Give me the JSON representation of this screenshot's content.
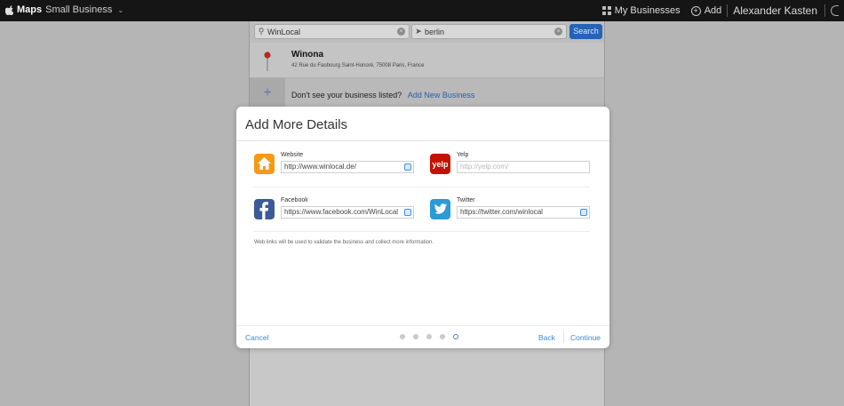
{
  "topbar": {
    "brand_bold": "Maps",
    "brand_rest": "Small Business",
    "my_businesses": "My Businesses",
    "add": "Add",
    "user": "Alexander Kasten"
  },
  "search": {
    "query": "WinLocal",
    "location": "berlin",
    "button": "Search"
  },
  "result": {
    "name": "Winona",
    "address": "42 Rue du Faubourg Saint-Honoré, 75008 Paris, France"
  },
  "add_row": {
    "question": "Don't see your business listed?",
    "link": "Add New Business"
  },
  "modal": {
    "title": "Add More Details",
    "website": {
      "label": "Website",
      "value": "http://www.winlocal.de/"
    },
    "yelp": {
      "label": "Yelp",
      "placeholder": "http://yelp.com/"
    },
    "facebook": {
      "label": "Facebook",
      "value": "https://www.facebook.com/WinLocal"
    },
    "twitter": {
      "label": "Twitter",
      "value": "https://twitter.com/winlocal"
    },
    "note": "Web links will be used to validate the business and collect more information.",
    "cancel": "Cancel",
    "back": "Back",
    "continue": "Continue",
    "step_current": 5,
    "step_total": 5
  },
  "colors": {
    "accent": "#3f86d6",
    "search_button": "#2463b8"
  }
}
